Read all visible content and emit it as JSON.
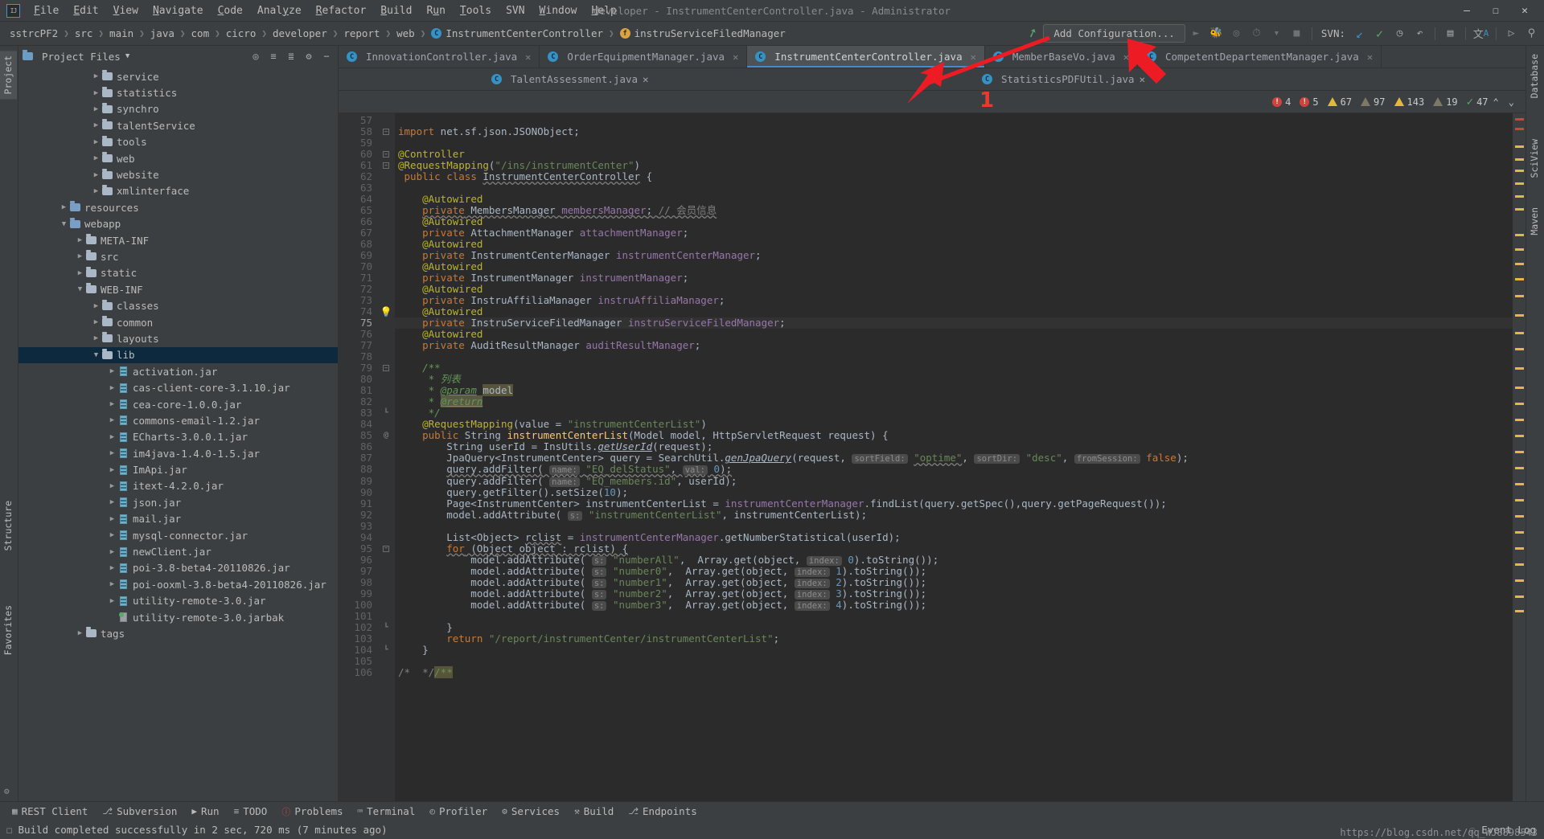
{
  "window": {
    "title": "developer - InstrumentCenterController.java - Administrator",
    "minimize": "–",
    "maximize": "☐",
    "close": "✕"
  },
  "menu": [
    "File",
    "Edit",
    "View",
    "Navigate",
    "Code",
    "Analyze",
    "Refactor",
    "Build",
    "Run",
    "Tools",
    "SVN",
    "Window",
    "Help"
  ],
  "breadcrumbs": [
    {
      "label": "sstrcPF2",
      "icon": ""
    },
    {
      "label": "src",
      "icon": ""
    },
    {
      "label": "main",
      "icon": ""
    },
    {
      "label": "java",
      "icon": ""
    },
    {
      "label": "com",
      "icon": ""
    },
    {
      "label": "cicro",
      "icon": ""
    },
    {
      "label": "developer",
      "icon": ""
    },
    {
      "label": "report",
      "icon": ""
    },
    {
      "label": "web",
      "icon": ""
    },
    {
      "label": "InstrumentCenterController",
      "icon": "class-icon"
    },
    {
      "label": "instruServiceFiledManager",
      "icon": "field-icon"
    }
  ],
  "toolbar": {
    "add_configuration": "Add Configuration...",
    "svn_label": "SVN:",
    "icons": [
      "run-icon",
      "debug-icon",
      "run-coverage-icon",
      "profile-icon",
      "dropdown-icon",
      "stop-icon",
      "svn-update-icon",
      "svn-commit-icon",
      "svn-history-icon",
      "svn-revert-icon",
      "project-structure-icon",
      "translate-icon",
      "terminal-icon",
      "search-everywhere-icon"
    ]
  },
  "project_panel": {
    "title": "Project Files",
    "header_icons": [
      "locate-icon",
      "expand-all-icon",
      "collapse-all-icon",
      "settings-icon",
      "hide-icon"
    ],
    "tree": [
      {
        "label": "service",
        "depth": 4,
        "type": "folder",
        "arrow": "right"
      },
      {
        "label": "statistics",
        "depth": 4,
        "type": "folder",
        "arrow": "right"
      },
      {
        "label": "synchro",
        "depth": 4,
        "type": "folder",
        "arrow": "right"
      },
      {
        "label": "talentService",
        "depth": 4,
        "type": "folder",
        "arrow": "right"
      },
      {
        "label": "tools",
        "depth": 4,
        "type": "folder",
        "arrow": "right"
      },
      {
        "label": "web",
        "depth": 4,
        "type": "folder",
        "arrow": "right"
      },
      {
        "label": "website",
        "depth": 4,
        "type": "folder",
        "arrow": "right"
      },
      {
        "label": "xmlinterface",
        "depth": 4,
        "type": "folder",
        "arrow": "right"
      },
      {
        "label": "resources",
        "depth": 2,
        "type": "folder-src",
        "arrow": "right"
      },
      {
        "label": "webapp",
        "depth": 2,
        "type": "folder-src",
        "arrow": "down"
      },
      {
        "label": "META-INF",
        "depth": 3,
        "type": "folder",
        "arrow": "right"
      },
      {
        "label": "src",
        "depth": 3,
        "type": "folder",
        "arrow": "right"
      },
      {
        "label": "static",
        "depth": 3,
        "type": "folder",
        "arrow": "right"
      },
      {
        "label": "WEB-INF",
        "depth": 3,
        "type": "folder",
        "arrow": "down"
      },
      {
        "label": "classes",
        "depth": 4,
        "type": "folder",
        "arrow": "right"
      },
      {
        "label": "common",
        "depth": 4,
        "type": "folder",
        "arrow": "right"
      },
      {
        "label": "layouts",
        "depth": 4,
        "type": "folder",
        "arrow": "right"
      },
      {
        "label": "lib",
        "depth": 4,
        "type": "folder",
        "arrow": "down",
        "selected": true
      },
      {
        "label": "activation.jar",
        "depth": 5,
        "type": "jar",
        "arrow": "right"
      },
      {
        "label": "cas-client-core-3.1.10.jar",
        "depth": 5,
        "type": "jar",
        "arrow": "right"
      },
      {
        "label": "cea-core-1.0.0.jar",
        "depth": 5,
        "type": "jar",
        "arrow": "right"
      },
      {
        "label": "commons-email-1.2.jar",
        "depth": 5,
        "type": "jar",
        "arrow": "right"
      },
      {
        "label": "ECharts-3.0.0.1.jar",
        "depth": 5,
        "type": "jar",
        "arrow": "right"
      },
      {
        "label": "im4java-1.4.0-1.5.jar",
        "depth": 5,
        "type": "jar",
        "arrow": "right"
      },
      {
        "label": "ImApi.jar",
        "depth": 5,
        "type": "jar",
        "arrow": "right"
      },
      {
        "label": "itext-4.2.0.jar",
        "depth": 5,
        "type": "jar",
        "arrow": "right"
      },
      {
        "label": "json.jar",
        "depth": 5,
        "type": "jar",
        "arrow": "right"
      },
      {
        "label": "mail.jar",
        "depth": 5,
        "type": "jar",
        "arrow": "right"
      },
      {
        "label": "mysql-connector.jar",
        "depth": 5,
        "type": "jar",
        "arrow": "right"
      },
      {
        "label": "newClient.jar",
        "depth": 5,
        "type": "jar",
        "arrow": "right"
      },
      {
        "label": "poi-3.8-beta4-20110826.jar",
        "depth": 5,
        "type": "jar",
        "arrow": "right"
      },
      {
        "label": "poi-ooxml-3.8-beta4-20110826.jar",
        "depth": 5,
        "type": "jar",
        "arrow": "right"
      },
      {
        "label": "utility-remote-3.0.jar",
        "depth": 5,
        "type": "jar",
        "arrow": "right"
      },
      {
        "label": "utility-remote-3.0.jarbak",
        "depth": 5,
        "type": "jarbak",
        "arrow": "none"
      },
      {
        "label": "tags",
        "depth": 3,
        "type": "folder",
        "arrow": "right"
      }
    ]
  },
  "left_strip": [
    "Project",
    "Structure",
    "Favorites"
  ],
  "right_strip": [
    "Database",
    "SciView",
    "Maven"
  ],
  "editor_tabs_row1": [
    {
      "label": "InnovationController.java",
      "active": false,
      "icon": "class-icon"
    },
    {
      "label": "OrderEquipmentManager.java",
      "active": false,
      "icon": "class-icon"
    },
    {
      "label": "InstrumentCenterController.java",
      "active": true,
      "icon": "class-icon"
    },
    {
      "label": "MemberBaseVo.java",
      "active": false,
      "icon": "class-icon"
    },
    {
      "label": "CompetentDepartementManager.java",
      "active": false,
      "icon": "class-icon"
    }
  ],
  "editor_tabs_row2": [
    {
      "label": "TalentAssessment.java",
      "active": false,
      "icon": "class-icon"
    },
    {
      "label": "StatisticsPDFUtil.java",
      "active": false,
      "icon": "class-icon"
    }
  ],
  "inspections": [
    {
      "icon": "error-icon",
      "count": "4",
      "color": "#d0433d"
    },
    {
      "icon": "error-icon",
      "count": "5",
      "color": "#d0433d"
    },
    {
      "icon": "warning-icon",
      "count": "67",
      "color": "#e2b93d"
    },
    {
      "icon": "weak-warning-icon",
      "count": "97",
      "color": "#7e7966"
    },
    {
      "icon": "warning-icon",
      "count": "143",
      "color": "#e2b93d"
    },
    {
      "icon": "weak-warning-icon",
      "count": "19",
      "color": "#7e7966"
    },
    {
      "icon": "ok-icon",
      "count": "47",
      "color": "#59a869"
    }
  ],
  "code": {
    "first_line": 57,
    "current_line": 75,
    "lines": [
      {
        "n": 57,
        "html": ""
      },
      {
        "n": 58,
        "html": "<span class=\"kw\">import</span> net.sf.json.JSONObject;",
        "fold": "minus"
      },
      {
        "n": 59,
        "html": ""
      },
      {
        "n": 60,
        "html": "<span class=\"ann\">@Controller</span>",
        "fold": "minus"
      },
      {
        "n": 61,
        "html": "<span class=\"ann\">@RequestMapping</span>(<span class=\"str\">\"/ins/instrumentCenter\"</span>)",
        "fold": "minus"
      },
      {
        "n": 62,
        "html": " <span class=\"kw\">public class</span> <span class=\"wavy\">InstrumentCenterController</span> {"
      },
      {
        "n": 63,
        "html": ""
      },
      {
        "n": 64,
        "html": "    <span class=\"ann\">@Autowired</span>"
      },
      {
        "n": 65,
        "html": "    <span class=\"wavy\"><span class=\"kw\">private</span> MembersManager <span class=\"fld\">membersManager</span>; <span class=\"cmt\">// 会员信息</span></span>"
      },
      {
        "n": 66,
        "html": "    <span class=\"ann\">@Autowired</span>"
      },
      {
        "n": 67,
        "html": "    <span class=\"kw\">private</span> AttachmentManager <span class=\"fld\">attachmentManager</span>;"
      },
      {
        "n": 68,
        "html": "    <span class=\"ann\">@Autowired</span>"
      },
      {
        "n": 69,
        "html": "    <span class=\"kw\">private</span> InstrumentCenterManager <span class=\"fld\">instrumentCenterManager</span>;"
      },
      {
        "n": 70,
        "html": "    <span class=\"ann\">@Autowired</span>"
      },
      {
        "n": 71,
        "html": "    <span class=\"kw\">private</span> InstrumentManager <span class=\"fld\">instrumentManager</span>;"
      },
      {
        "n": 72,
        "html": "    <span class=\"ann\">@Autowired</span>"
      },
      {
        "n": 73,
        "html": "    <span class=\"kw\">private</span> InstruAffiliaManager <span class=\"fld\">instruAffiliaManager</span>;"
      },
      {
        "n": 74,
        "html": "    <span class=\"ann\">@Autowired</span>",
        "bulb": true
      },
      {
        "n": 75,
        "html": "    <span class=\"kw\">private</span> InstruServiceFiledManager <span class=\"fld\">instruServiceFiledManager</span>;",
        "cur": true
      },
      {
        "n": 76,
        "html": "    <span class=\"ann\">@Autowired</span>"
      },
      {
        "n": 77,
        "html": "    <span class=\"kw\">private</span> AuditResultManager <span class=\"fld\">auditResultManager</span>;"
      },
      {
        "n": 78,
        "html": ""
      },
      {
        "n": 79,
        "html": "    <span class=\"jd\">/**</span>",
        "fold": "minus"
      },
      {
        "n": 80,
        "html": "     <span class=\"jd\">* 列表</span>"
      },
      {
        "n": 81,
        "html": "     <span class=\"jd\">* </span><span class=\"jdt\">@param</span> <span class=\"hl\">model</span>"
      },
      {
        "n": 82,
        "html": "     <span class=\"jd\">* </span><span class=\"hl2\"><span class=\"jdt\">@return</span></span>"
      },
      {
        "n": 83,
        "html": "     <span class=\"jd\">*/</span>",
        "fold": "end"
      },
      {
        "n": 84,
        "html": "    <span class=\"ann\">@RequestMapping</span>(value = <span class=\"str\">\"instrumentCenterList\"</span>)"
      },
      {
        "n": 85,
        "html": "    <span class=\"kw\">public</span> String <span class=\"mth\">instrumentCenterList</span>(Model model, HttpServletRequest request) {",
        "gmark": "@",
        "fold": "minus"
      },
      {
        "n": 86,
        "html": "        String userId = InsUtils.<span class=\"stm\">getUserId</span>(request);"
      },
      {
        "n": 87,
        "html": "        JpaQuery&lt;InstrumentCenter&gt; query = SearchUtil.<span class=\"stm\">genJpaQuery</span>(request, <span class=\"hint\">sortField:</span> <span class=\"str wavy\">\"optime\"</span>, <span class=\"hint\">sortDir:</span> <span class=\"str\">\"desc\"</span>, <span class=\"hint\">fromSession:</span> <span class=\"kw\">false</span>);"
      },
      {
        "n": 88,
        "html": "        <span class=\"wavy\">query.addFilter( <span class=\"hint\">name:</span> <span class=\"str\">\"EQ_delStatus\"</span>, <span class=\"hint\">val:</span> <span class=\"num\">0</span>);</span>"
      },
      {
        "n": 89,
        "html": "        query.addFilter( <span class=\"hint\">name:</span> <span class=\"str\">\"EQ_members.id\"</span>, userId);"
      },
      {
        "n": 90,
        "html": "        query.getFilter().setSize(<span class=\"num\">10</span>);"
      },
      {
        "n": 91,
        "html": "        Page&lt;InstrumentCenter&gt; instrumentCenterList = <span class=\"fld\">instrumentCenterManager</span>.findList(query.getSpec(),query.getPageRequest());"
      },
      {
        "n": 92,
        "html": "        model.addAttribute( <span class=\"hint\">s:</span> <span class=\"str\">\"instrumentCenterList\"</span>, instrumentCenterList);"
      },
      {
        "n": 93,
        "html": ""
      },
      {
        "n": 94,
        "html": "        List&lt;Object&gt; <span class=\"wavy\">rclist</span> = <span class=\"fld\">instrumentCenterManager</span>.getNumberStatistical(userId);"
      },
      {
        "n": 95,
        "html": "        <span class=\"wavy\"><span class=\"kw\">for</span> (Object object : rclist) {</span>",
        "fold": "minus"
      },
      {
        "n": 96,
        "html": "            model.addAttribute( <span class=\"hint\">s:</span> <span class=\"str\">\"numberAll\"</span>,  Array.get(object, <span class=\"hint\">index:</span> <span class=\"num\">0</span>).toString());"
      },
      {
        "n": 97,
        "html": "            model.addAttribute( <span class=\"hint\">s:</span> <span class=\"str\">\"number0\"</span>,  Array.get(object, <span class=\"hint\">index:</span> <span class=\"num\">1</span>).toString());"
      },
      {
        "n": 98,
        "html": "            model.addAttribute( <span class=\"hint\">s:</span> <span class=\"str\">\"number1\"</span>,  Array.get(object, <span class=\"hint\">index:</span> <span class=\"num\">2</span>).toString());"
      },
      {
        "n": 99,
        "html": "            model.addAttribute( <span class=\"hint\">s:</span> <span class=\"str\">\"number2\"</span>,  Array.get(object, <span class=\"hint\">index:</span> <span class=\"num\">3</span>).toString());"
      },
      {
        "n": 100,
        "html": "            model.addAttribute( <span class=\"hint\">s:</span> <span class=\"str\">\"number3\"</span>,  Array.get(object, <span class=\"hint\">index:</span> <span class=\"num\">4</span>).toString());"
      },
      {
        "n": 101,
        "html": ""
      },
      {
        "n": 102,
        "html": "        }",
        "fold": "end"
      },
      {
        "n": 103,
        "html": "        <span class=\"kw\">return</span> <span class=\"str\">\"/report/instrumentCenter/instrumentCenterList\"</span>;"
      },
      {
        "n": 104,
        "html": "    }",
        "fold": "end"
      },
      {
        "n": 105,
        "html": ""
      },
      {
        "n": 106,
        "html": "<span class=\"cmt\">/*  */</span><span class=\"hl\"><span class=\"jd\">/**</span></span>"
      }
    ]
  },
  "bottom_tools": [
    {
      "label": "REST Client",
      "icon": "rest-icon"
    },
    {
      "label": "Subversion",
      "icon": "subversion-icon"
    },
    {
      "label": "Run",
      "icon": "run-icon"
    },
    {
      "label": "TODO",
      "icon": "todo-icon"
    },
    {
      "label": "Problems",
      "icon": "problems-icon"
    },
    {
      "label": "Terminal",
      "icon": "terminal-icon"
    },
    {
      "label": "Profiler",
      "icon": "profiler-icon"
    },
    {
      "label": "Services",
      "icon": "services-icon"
    },
    {
      "label": "Build",
      "icon": "build-icon"
    },
    {
      "label": "Endpoints",
      "icon": "endpoints-icon"
    }
  ],
  "status": {
    "message": "Build completed successfully in 2 sec, 720 ms (7 minutes ago)",
    "event_log": "Event Log",
    "watermark": "https://blog.csdn.net/qq_WJ8898543"
  },
  "annotations": {
    "marker_1": "1"
  },
  "colors": {
    "accent": "#4a88c7",
    "error": "#d0433d",
    "warning": "#e2b93d",
    "ok": "#59a869",
    "panel": "#3c3f41",
    "editor_bg": "#2b2b2b",
    "red_arrow": "#e83b2f"
  }
}
